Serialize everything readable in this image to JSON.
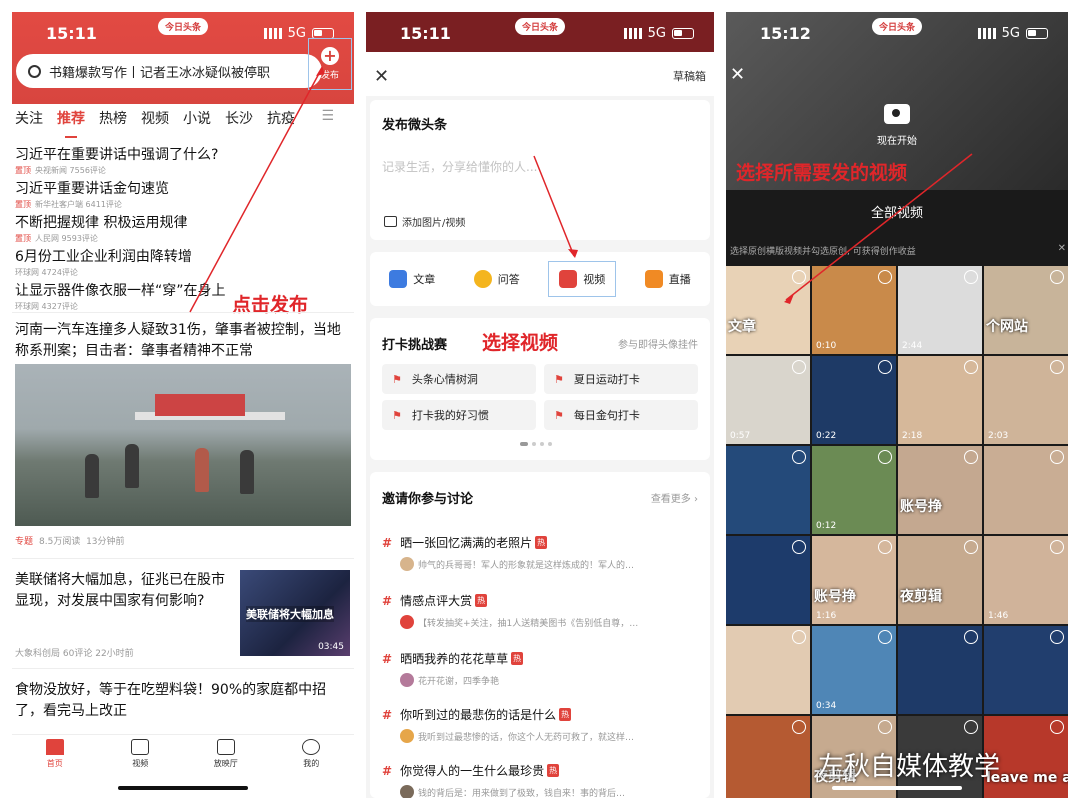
{
  "panel1": {
    "time": "15:11",
    "network": "5G",
    "app_pill": "今日头条",
    "search_text": "书籍爆款写作丨记者王冰冰疑似被停职",
    "publish_label": "发布",
    "tabs": [
      "关注",
      "推荐",
      "热榜",
      "视频",
      "小说",
      "长沙",
      "抗疫"
    ],
    "news": [
      {
        "title": "习近平在重要讲话中强调了什么?",
        "tag": "置顶",
        "source": "央视新闻",
        "comments": "7556评论"
      },
      {
        "title": "习近平重要讲话金句速览",
        "tag": "置顶",
        "source": "新华社客户端",
        "comments": "6411评论"
      },
      {
        "title": "不断把握规律 积极运用规律",
        "tag": "置顶",
        "source": "人民网",
        "comments": "9593评论"
      },
      {
        "title": "6月份工业企业利润由降转增",
        "tag": "",
        "source": "环球网",
        "comments": "4724评论"
      },
      {
        "title": "让显示器件像衣服一样“穿”在身上",
        "tag": "",
        "source": "环球网",
        "comments": "4327评论"
      }
    ],
    "big_story": {
      "title": "河南一汽车连撞多人疑致31伤，肇事者被控制，当地称系刑案；目击者：肇事者精神不正常",
      "tag": "专题",
      "reads": "8.5万阅读",
      "time": "13分钟前"
    },
    "fed_story": {
      "title": "美联储将大幅加息，征兆已在股市显现，对发展中国家有何影响?",
      "source": "大象科创局",
      "comments": "60评论",
      "time": "22小时前",
      "thumb_caption": "美联储将大幅加息",
      "duration": "03:45"
    },
    "food_story": {
      "title": "食物没放好，等于在吃塑料袋！90%的家庭都中招了，看完马上改正"
    },
    "bottom_nav": [
      "首页",
      "视频",
      "放映厅",
      "我的"
    ],
    "annotation": "点击发布"
  },
  "panel2": {
    "time": "15:11",
    "network": "5G",
    "app_pill": "今日头条",
    "drafts": "草稿箱",
    "compose_title": "发布微头条",
    "placeholder": "记录生活，分享给懂你的人...",
    "add_media": "添加图片/视频",
    "types": [
      "文章",
      "问答",
      "视频",
      "直播"
    ],
    "checkin_title": "打卡挑战赛",
    "checkin_more": "参与即得头像挂件",
    "topics": [
      "头条心情树洞",
      "夏日运动打卡",
      "打卡我的好习惯",
      "每日金句打卡"
    ],
    "discuss_title": "邀请你参与讨论",
    "discuss_more": "查看更多",
    "hot_label": "热",
    "discussions": [
      {
        "title": "晒一张回忆满满的老照片",
        "snippet": "帅气的兵哥哥！军人的形象就是这样炼成的！军人的…"
      },
      {
        "title": "情感点评大赏",
        "snippet": "【转发抽奖+关注，抽1人送精美图书《告别低自尊，…"
      },
      {
        "title": "晒晒我养的花花草草",
        "snippet": "花开花谢，四季争艳"
      },
      {
        "title": "你听到过的最悲伤的话是什么",
        "snippet": "我听到过最悲惨的话，你这个人无药可救了，就这样…"
      },
      {
        "title": "你觉得人的一生什么最珍贵",
        "snippet": "钱的背后是：用来做到了极致，钱自来！事的背后…"
      }
    ],
    "annotation": "选择视频"
  },
  "panel3": {
    "time": "15:12",
    "network": "5G",
    "app_pill": "今日头条",
    "camera_label": "现在开始",
    "all_videos": "全部视频",
    "tip": "选择原创横版视频并勾选原创, 可获得创作收益",
    "annotation": "选择所需要发的视频",
    "watermark": "左秋自媒体教学",
    "cells": [
      {
        "cap": "文章",
        "dur": "",
        "bg": "#e8d2b6"
      },
      {
        "cap": "",
        "dur": "0:10",
        "bg": "#c98a4a"
      },
      {
        "cap": "",
        "dur": "2:44",
        "bg": "#dcdcdc"
      },
      {
        "cap": "个网站",
        "dur": "",
        "bg": "#c8b49a"
      },
      {
        "cap": "",
        "dur": "0:57",
        "bg": "#d9d5cc"
      },
      {
        "cap": "",
        "dur": "0:22",
        "bg": "#1e3a66"
      },
      {
        "cap": "",
        "dur": "2:18",
        "bg": "#d6b89a"
      },
      {
        "cap": "",
        "dur": "2:03",
        "bg": "#cfb499"
      },
      {
        "cap": "",
        "dur": "",
        "bg": "#244a7a"
      },
      {
        "cap": "",
        "dur": "0:12",
        "bg": "#6b8b54"
      },
      {
        "cap": "账号挣",
        "dur": "",
        "bg": "#c4a890"
      },
      {
        "cap": "",
        "dur": "",
        "bg": "#c9ad94"
      },
      {
        "cap": "",
        "dur": "",
        "bg": "#1d3b6b"
      },
      {
        "cap": "账号挣",
        "dur": "1:16",
        "bg": "#d5b79c"
      },
      {
        "cap": "夜剪辑",
        "dur": "",
        "bg": "#c6aa8f"
      },
      {
        "cap": "",
        "dur": "1:46",
        "bg": "#d0b39a"
      },
      {
        "cap": "",
        "dur": "",
        "bg": "#e2cbb2"
      },
      {
        "cap": "",
        "dur": "0:34",
        "bg": "#4f86b6"
      },
      {
        "cap": "",
        "dur": "",
        "bg": "#1e3a68"
      },
      {
        "cap": "",
        "dur": "",
        "bg": "#213e6e"
      },
      {
        "cap": "",
        "dur": "",
        "bg": "#b55a32"
      },
      {
        "cap": "夜剪辑",
        "dur": "",
        "bg": "#c6aa8f"
      },
      {
        "cap": "",
        "dur": "",
        "bg": "#3a3a3a"
      },
      {
        "cap": "leave me alon",
        "dur": "",
        "bg": "#b7382a"
      }
    ]
  },
  "colors": {
    "brand_red": "#e0433c",
    "annotation_red": "#e0262a",
    "highlight_blue": "#9ec4ea"
  }
}
